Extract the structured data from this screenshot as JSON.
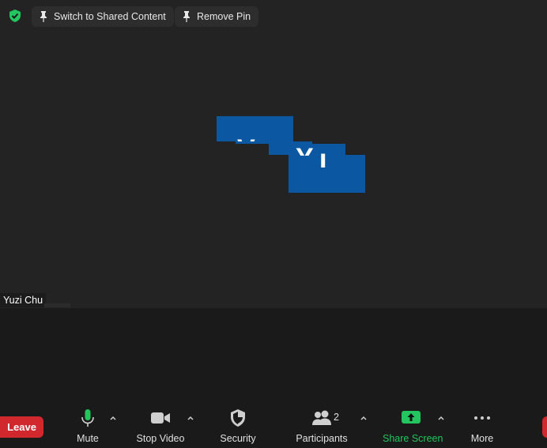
{
  "top_bar": {
    "switch_label": "Switch to Shared Content",
    "remove_pin_label": "Remove Pin"
  },
  "video": {
    "participant_name": "Yuzi Chu",
    "avatar_glyphs": [
      "V",
      "Y",
      "I"
    ]
  },
  "toolbar": {
    "leave_label": "Leave",
    "mute_label": "Mute",
    "stop_video_label": "Stop Video",
    "security_label": "Security",
    "participants_label": "Participants",
    "participants_count": "2",
    "share_screen_label": "Share Screen",
    "more_label": "More"
  },
  "colors": {
    "accent_green": "#22c55e",
    "leave_red": "#d1282e",
    "avatar_blue": "#0c57a1"
  },
  "icons": [
    "shield-check-icon",
    "pin-icon",
    "microphone-icon",
    "video-camera-icon",
    "shield-icon",
    "participants-icon",
    "share-screen-arrow-icon",
    "more-dots-icon",
    "chevron-up-icon"
  ]
}
